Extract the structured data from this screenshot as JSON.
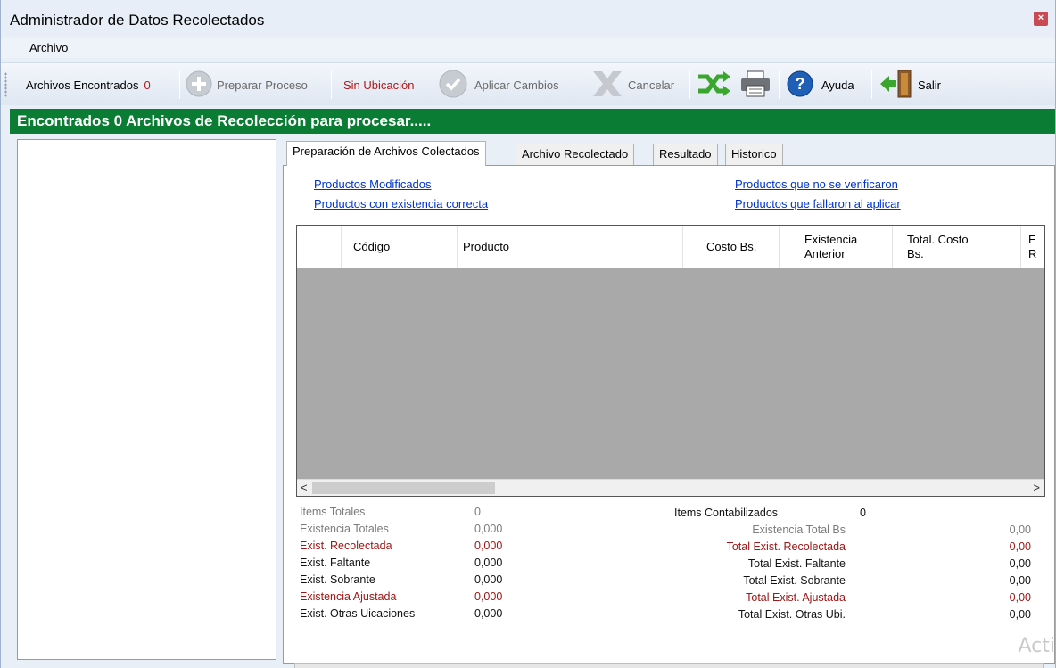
{
  "window": {
    "title": "Administrador de Datos Recolectados",
    "close_glyph": "×"
  },
  "menu": {
    "archivo": "Archivo"
  },
  "toolbar": {
    "archivos_encontrados_label": "Archivos Encontrados",
    "archivos_encontrados_count": "0",
    "preparar_proceso": "Preparar Proceso",
    "sin_ubicacion": "Sin Ubicación",
    "aplicar_cambios": "Aplicar Cambios",
    "cancelar": "Cancelar",
    "ayuda": "Ayuda",
    "salir": "Salir",
    "icons": [
      "plus-circle-icon",
      "check-circle-icon",
      "x-icon",
      "shuffle-icon",
      "printer-icon",
      "help-icon",
      "exit-door-icon"
    ]
  },
  "banner": {
    "text": "Encontrados 0 Archivos de Recolección para procesar....."
  },
  "tabs": [
    {
      "label": "Preparación de Archivos Colectados",
      "active": true
    },
    {
      "label": "Archivo Recolectado"
    },
    {
      "label": "Resultado"
    },
    {
      "label": "Historico"
    }
  ],
  "links": {
    "productos_modificados": "Productos Modificados",
    "productos_existencia_correcta": "Productos con existencia correcta",
    "productos_no_verificaron": "Productos que no se verificaron",
    "productos_fallaron": "Productos que fallaron al aplicar"
  },
  "grid": {
    "columns": [
      "Código",
      "Producto",
      "Costo Bs.",
      "Existencia Anterior",
      "Total. Costo Bs.",
      "E R"
    ],
    "rows": [],
    "scroll_left": "<",
    "scroll_right": ">"
  },
  "stats_left": [
    {
      "label": "Items Totales",
      "value": "0",
      "style": "gray"
    },
    {
      "label": "Existencia Totales",
      "value": "0,000",
      "style": "gray"
    },
    {
      "label": "Exist. Recolectada",
      "value": "0,000",
      "style": "red"
    },
    {
      "label": "Exist. Faltante",
      "value": "0,000",
      "style": "black"
    },
    {
      "label": "Exist. Sobrante",
      "value": "0,000",
      "style": "black"
    },
    {
      "label": "Existencia Ajustada",
      "value": "0,000",
      "style": "red"
    },
    {
      "label": "Exist. Otras Uicaciones",
      "value": "0,000",
      "style": "black"
    }
  ],
  "items_contabilizados": {
    "label": "Items Contabilizados",
    "value": "0"
  },
  "stats_right": [
    {
      "label": "Existencia Total Bs",
      "value": "0,00",
      "style": "gray"
    },
    {
      "label": "Total Exist. Recolectada",
      "value": "0,00",
      "style": "red"
    },
    {
      "label": "Total Exist. Faltante",
      "value": "0,00",
      "style": "black"
    },
    {
      "label": "Total Exist. Sobrante",
      "value": "0,00",
      "style": "black"
    },
    {
      "label": "Total Exist. Ajustada",
      "value": "0,00",
      "style": "red"
    },
    {
      "label": "Total Exist. Otras Ubi.",
      "value": "0,00",
      "style": "black"
    }
  ],
  "watermark": "Acti",
  "colors": {
    "banner": "#0b7c33",
    "red_text": "#a01515",
    "link": "#0033cc"
  }
}
